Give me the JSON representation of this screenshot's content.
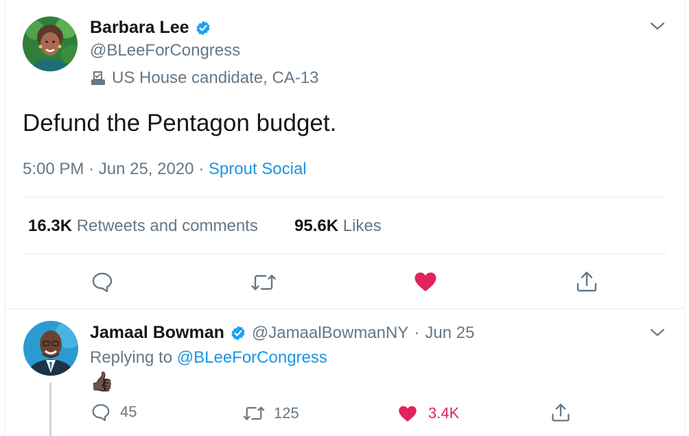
{
  "main_tweet": {
    "author_name": "Barbara Lee",
    "handle": "@BLeeForCongress",
    "label": "US House candidate, CA-13",
    "text": "Defund the Pentagon budget.",
    "time": "5:00 PM",
    "date": "Jun 25, 2020",
    "separator": "·",
    "source": "Sprout Social",
    "retweets_count": "16.3K",
    "retweets_label": "Retweets and comments",
    "likes_count": "95.6K",
    "likes_label": "Likes",
    "liked": true
  },
  "reply": {
    "author_name": "Jamaal Bowman",
    "handle": "@JamaalBowmanNY",
    "separator": "·",
    "date": "Jun 25",
    "replying_to_label": "Replying to",
    "replying_to_handle": "@BLeeForCongress",
    "text": "👍🏿",
    "reply_count": "45",
    "retweet_count": "125",
    "like_count": "3.4K",
    "liked": true
  },
  "colors": {
    "link_blue": "#1b95e0",
    "like_red": "#e0245e",
    "muted_gray": "#657786",
    "divider": "#e6ecf0"
  },
  "icons": {
    "reply": "speech-bubble-icon",
    "retweet": "retweet-arrows-icon",
    "like": "heart-icon",
    "share": "share-upload-icon",
    "verified": "verified-badge-icon",
    "menu": "chevron-down-icon",
    "label": "ballot-box-icon"
  }
}
